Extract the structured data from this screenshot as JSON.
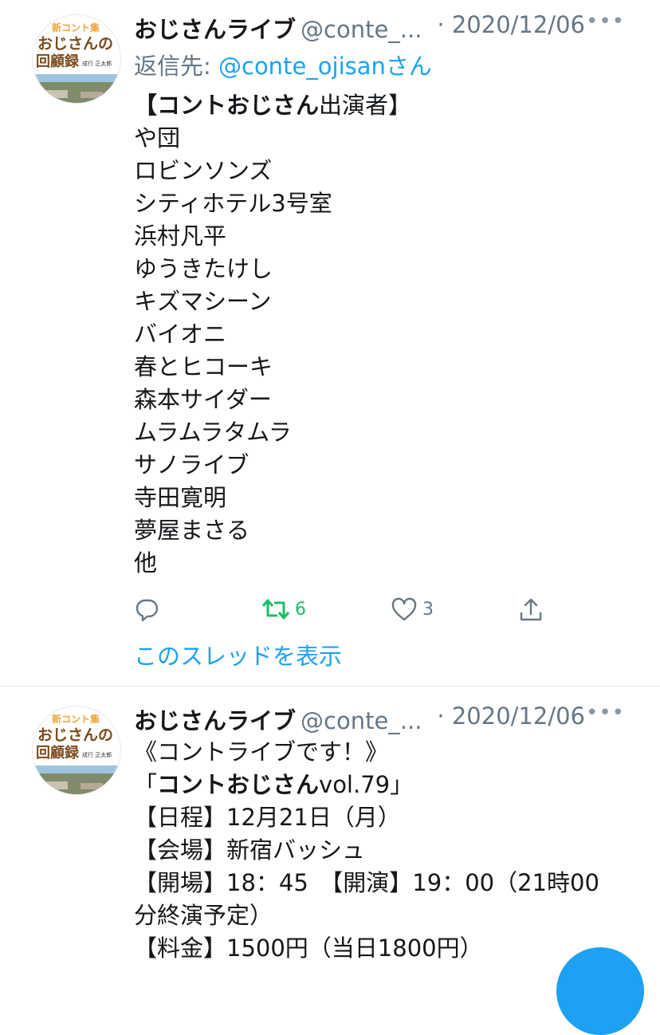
{
  "tweets": [
    {
      "name": "おじさんライブ",
      "handle": "@conte_...",
      "date": "· 2020/12/06",
      "more": "•••",
      "reply_prefix": "返信先: ",
      "reply_mention": "@conte_ojisan",
      "reply_suffix": "さん",
      "title_bold": "【コントおじさん",
      "title_rest": "出演者】",
      "lines": [
        "や団",
        "ロビンソンズ",
        "シティホテル3号室",
        "浜村凡平",
        "ゆうきたけし",
        "キズマシーン",
        "バイオニ",
        "春とヒコーキ",
        "森本サイダー",
        "ムラムラタムラ",
        "サノライブ",
        "寺田寛明",
        "夢屋まさる",
        "他"
      ],
      "retweets": "6",
      "likes": "3",
      "show_thread": "このスレッドを表示"
    },
    {
      "name": "おじさんライブ",
      "handle": "@conte_...",
      "date": "· 2020/12/06",
      "more": "•••",
      "line1": "《コントライブです！》",
      "line2_open": "「",
      "line2_bold": "コントおじさん",
      "line2_rest": "vol.79」",
      "lines": [
        "【日程】12月21日（月）",
        "【会場】新宿バッシュ",
        "【開場】18：45　【開演】19：00（21時00",
        "分終演予定）",
        "【料金】1500円（当日1800円）"
      ]
    }
  ],
  "avatar": {
    "top_text": "新コント集",
    "main_text": "おじさんの",
    "main_text2": "回顧録",
    "author_text": "成行 正太郎",
    "brand_color": "#7a4b1e",
    "accent_color": "#f0a43a"
  },
  "colors": {
    "accent": "#1da1f2",
    "retweet": "#17bf63",
    "muted": "#657786"
  }
}
